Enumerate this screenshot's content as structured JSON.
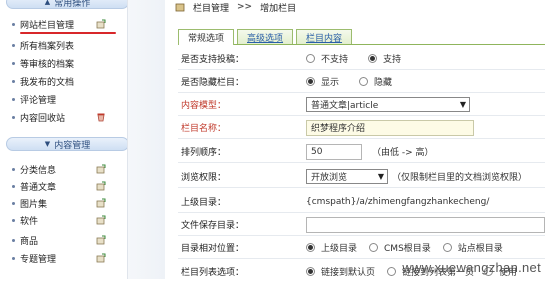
{
  "sidebar": {
    "common_group": {
      "title": "常用操作"
    },
    "common_items": [
      {
        "label": "网站栏目管理",
        "add": true
      },
      {
        "label": "所有档案列表",
        "add": false
      },
      {
        "label": "等审核的档案",
        "add": false
      },
      {
        "label": "我发布的文档",
        "add": false
      },
      {
        "label": "评论管理",
        "add": false
      },
      {
        "label": "内容回收站",
        "add": false
      }
    ],
    "content_group": {
      "title": "内容管理"
    },
    "content_items": [
      {
        "label": "分类信息",
        "add": true
      },
      {
        "label": "普通文章",
        "add": true
      },
      {
        "label": "图片集",
        "add": true
      },
      {
        "label": "软件",
        "add": true
      },
      {
        "label": "商品",
        "add": true
      },
      {
        "label": "专题管理",
        "add": true
      }
    ]
  },
  "breadcrumb": {
    "part1": "栏目管理",
    "separator": ">>",
    "part2": "增加栏目"
  },
  "tabs": [
    {
      "label": "常规选项",
      "active": true
    },
    {
      "label": "高级选项",
      "active": false
    },
    {
      "label": "栏目内容",
      "active": false
    }
  ],
  "form": {
    "allow_post": {
      "label": "是否支持投稿：",
      "opt1": "不支持",
      "opt2": "支持"
    },
    "hidden": {
      "label": "是否隐藏栏目：",
      "opt1": "显示",
      "opt2": "隐藏"
    },
    "content_model": {
      "label": "内容模型：",
      "value": "普通文章|article"
    },
    "column_name": {
      "label": "栏目名称：",
      "value": "织梦程序介绍"
    },
    "sort_order": {
      "label": "排列顺序：",
      "value": "50",
      "hint": "（由低 -> 高）"
    },
    "browse_perm": {
      "label": "浏览权限：",
      "value": "开放浏览",
      "hint": "（仅限制栏目里的文档浏览权限）"
    },
    "parent_dir": {
      "label": "上级目录：",
      "value": "{cmspath}/a/zhimengfangzhankecheng/"
    },
    "save_dir": {
      "label": "文件保存目录：",
      "value": ""
    },
    "relative_pos": {
      "label": "目录相对位置：",
      "opt1": "上级目录",
      "opt2": "CMS根目录",
      "opt3": "站点根目录"
    },
    "list_opt": {
      "label": "栏目列表选项：",
      "opt1": "链接到默认页",
      "opt2": "链接到列表第一页",
      "opt3": "使用"
    }
  },
  "watermark": "www.xuewangzhan.net",
  "colors": {
    "accent_red": "#d8272a",
    "tab_border": "#9cbc6e",
    "sidebar_header": "#cfdff3"
  }
}
